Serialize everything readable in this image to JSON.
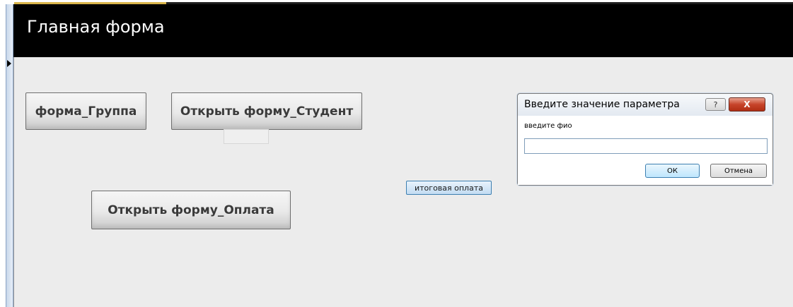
{
  "form": {
    "title": "Главная форма"
  },
  "buttons": {
    "group_label": "форма_Группа",
    "student_label": "Открыть форму_Студент",
    "payment_label": "Открыть форму_Оплата",
    "total_payment_label": "итоговая оплата"
  },
  "dialog": {
    "title": "Введите значение параметра",
    "prompt": "введите фио",
    "input_value": "",
    "ok_label": "ОК",
    "cancel_label": "Отмена",
    "help_symbol": "?",
    "close_symbol": "X"
  },
  "colors": {
    "header_background": "#000000",
    "form_background": "#ececec",
    "close_button": "#c7442a",
    "primary_button_border": "#3c7fb1"
  }
}
